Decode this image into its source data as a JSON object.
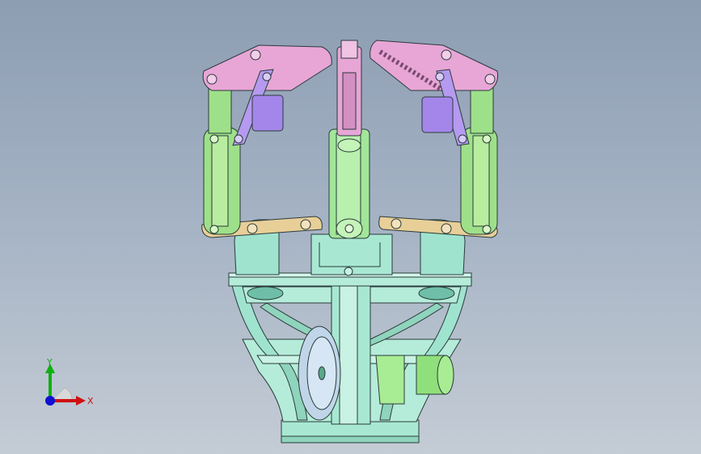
{
  "view": {
    "background_top": "#8d9db2",
    "background_bottom": "#c4ccd5"
  },
  "model": {
    "description_parts": [
      "base-mount",
      "cross-plate",
      "center-finger",
      "left-finger",
      "right-finger",
      "servo-disc",
      "motor-cylinder"
    ]
  },
  "triad": {
    "x_label": "X",
    "y_label": "Y",
    "x_color": "#d01010",
    "y_color": "#10b010",
    "z_color": "#1010d0"
  },
  "colors": {
    "base": "#9fe3cf",
    "green_link": "#9ee08a",
    "tan_link": "#e8cf98",
    "pink_link": "#e7a6d6",
    "violet_link": "#b59af0",
    "outline": "#2a3a3a"
  }
}
